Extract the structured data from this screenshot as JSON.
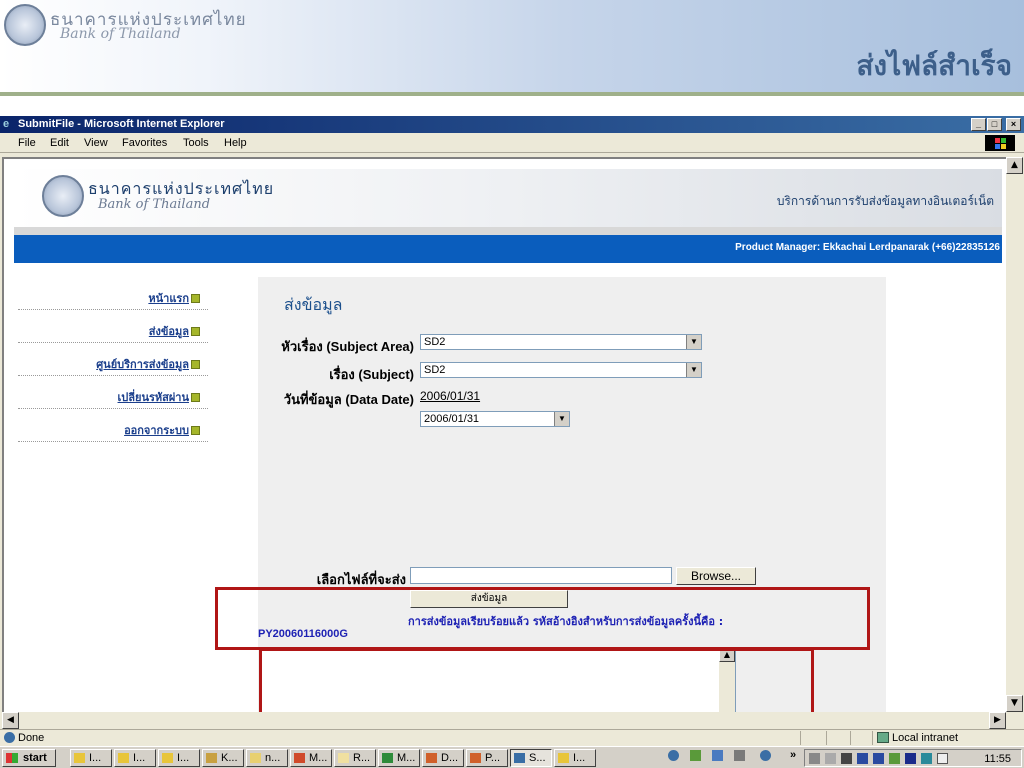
{
  "slide": {
    "logo_th": "ธนาคารแห่งประเทศไทย",
    "logo_en": "Bank of Thailand",
    "title": "ส่งไฟล์สำเร็จ"
  },
  "window": {
    "title": "SubmitFile - Microsoft Internet Explorer",
    "menu": [
      "File",
      "Edit",
      "View",
      "Favorites",
      "Tools",
      "Help"
    ],
    "status_text": "Done",
    "status_zone": "Local intranet"
  },
  "page": {
    "banner_th": "ธนาคารแห่งประเทศไทย",
    "banner_en": "Bank of Thailand",
    "service_text": "บริการด้านการรับส่งข้อมูลทางอินเตอร์เน็ต",
    "product_manager": "Product Manager: Ekkachai Lerdpanarak (+66)22835126",
    "nav": [
      {
        "label": "หน้าแรก"
      },
      {
        "label": "ส่งข้อมูล"
      },
      {
        "label": "ศูนย์บริการส่งข้อมูล"
      },
      {
        "label": "เปลี่ยนรหัสผ่าน"
      },
      {
        "label": "ออกจากระบบ"
      }
    ],
    "form": {
      "title": "ส่งข้อมูล",
      "subject_area_label": "หัวเรื่อง (Subject Area)",
      "subject_area_value": "SD2",
      "subject_label": "เรื่อง (Subject)",
      "subject_value": "SD2",
      "data_date_label": "วันที่ข้อมูล (Data Date)",
      "data_date_value": "2006/01/31",
      "data_date_select": "2006/01/31",
      "file_label": "เลือกไฟล์ที่จะส่ง",
      "browse_label": "Browse...",
      "submit_label": "ส่งข้อมูล",
      "result_message": "การส่งข้อมูลเรียบร้อยแล้ว รหัสอ้างอิงสำหรับการส่งข้อมูลครั้งนี้คือ :",
      "reference_code": "PY20060116000G"
    }
  },
  "taskbar": {
    "start_label": "start",
    "tasks": [
      "I...",
      "I...",
      "I...",
      "K...",
      "n...",
      "M...",
      "R...",
      "M...",
      "D...",
      "P...",
      "S...",
      "I..."
    ],
    "active_task_index": 10,
    "clock": "11:55"
  },
  "colors": {
    "nav_link": "#1b3f8c",
    "blue_bar": "#0a5dbd",
    "highlight_red": "#b01616",
    "result_text": "#1e22b4"
  }
}
